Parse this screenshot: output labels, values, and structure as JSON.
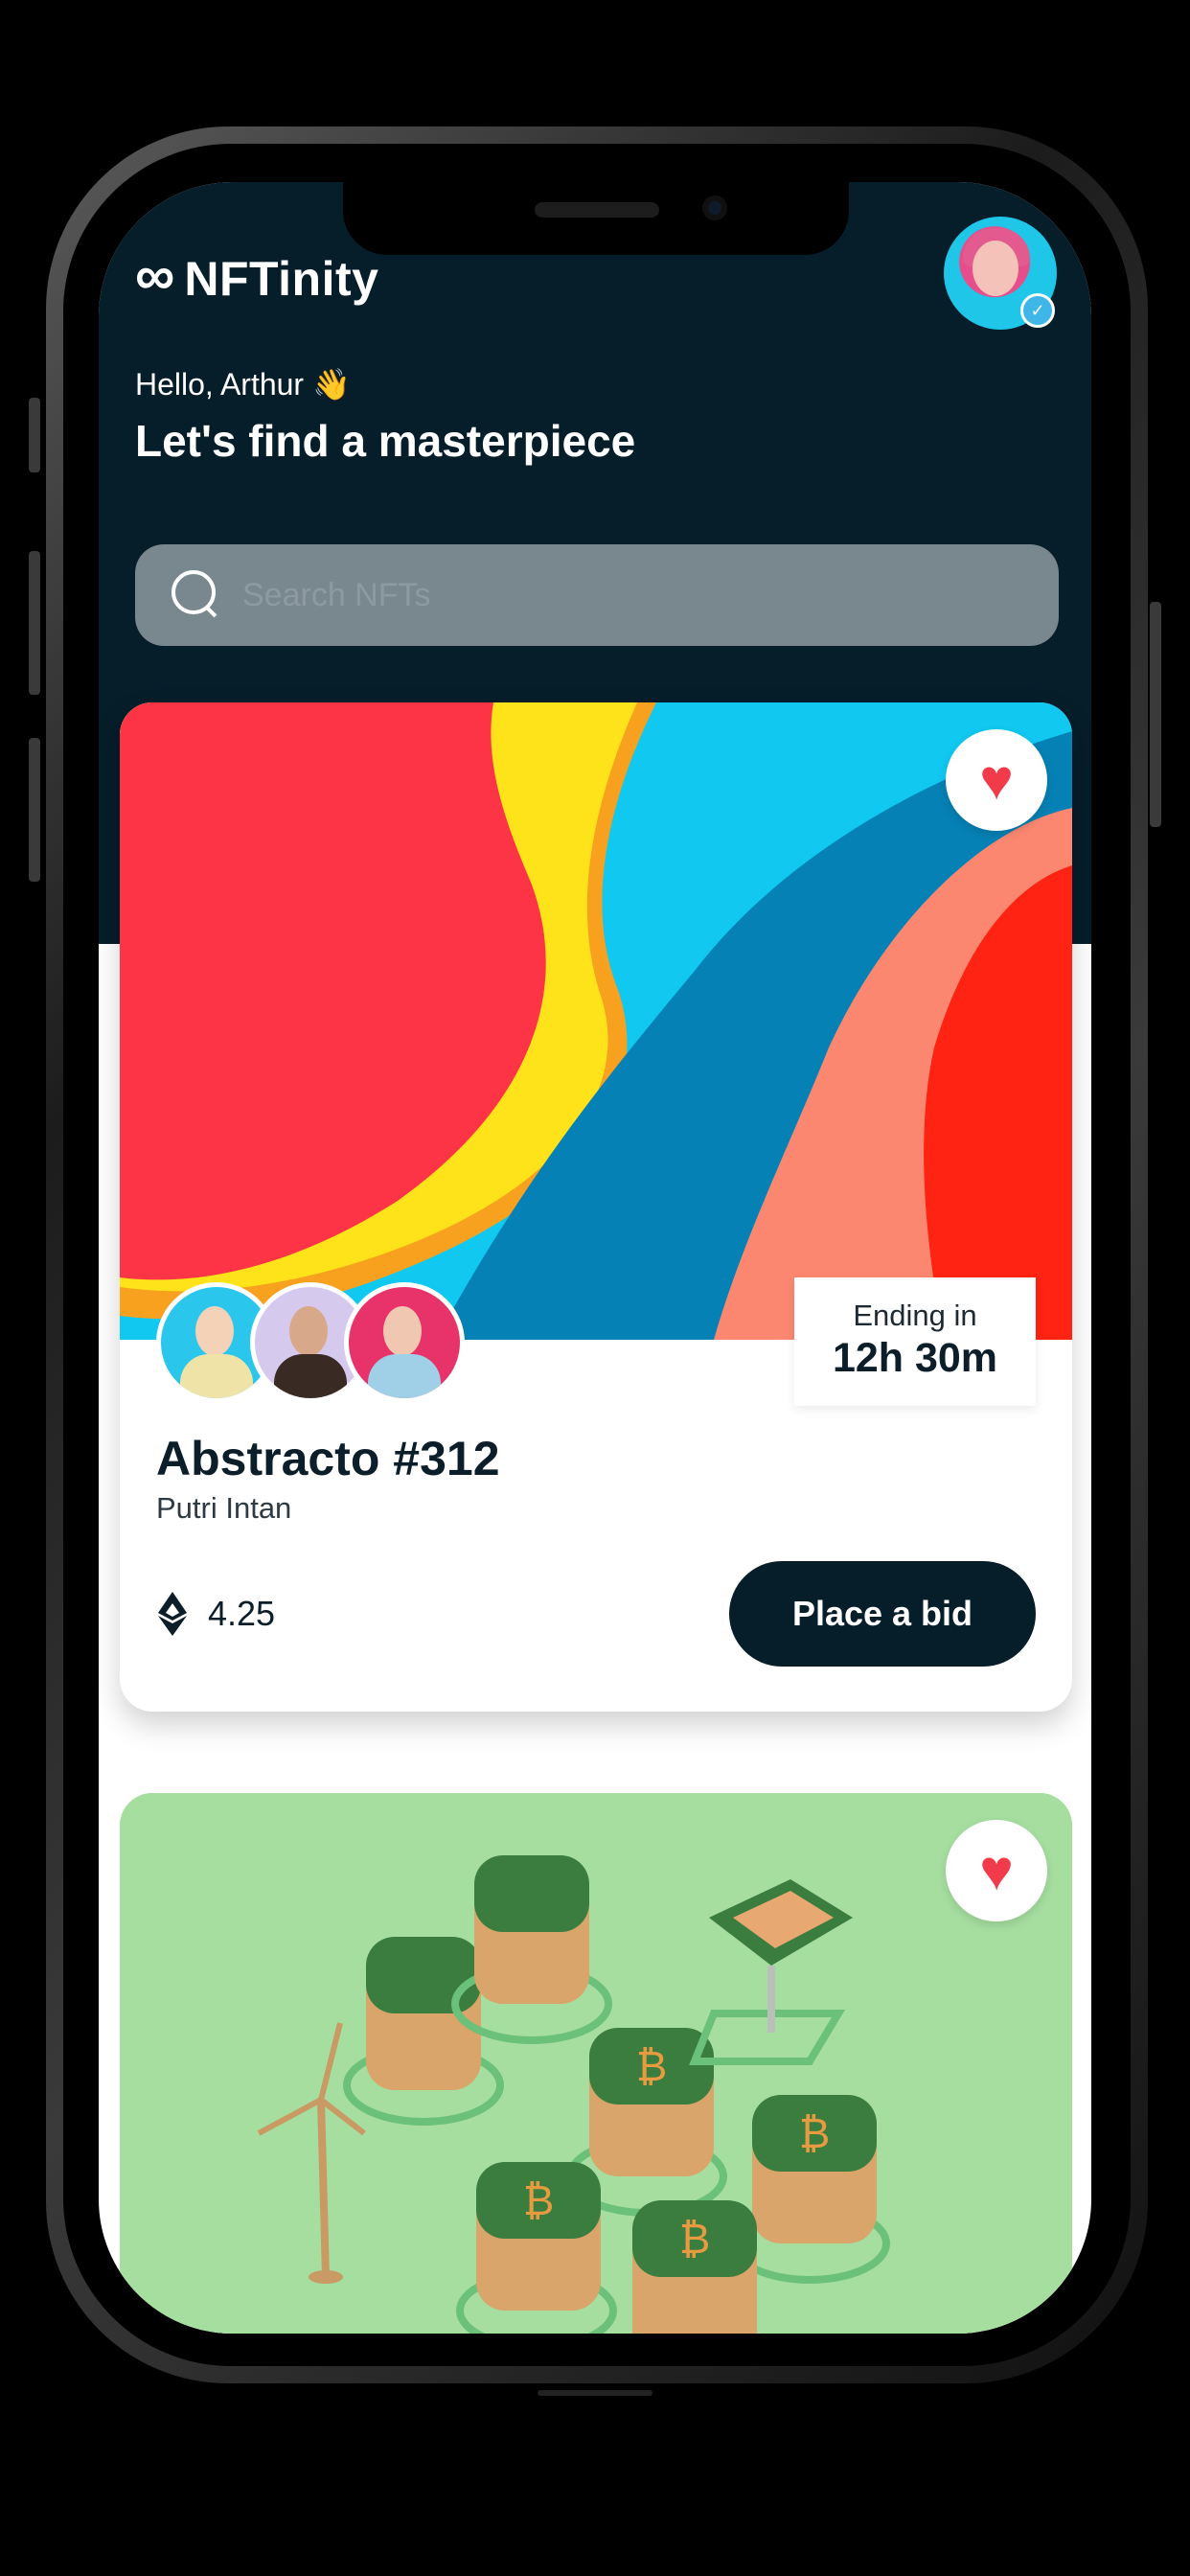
{
  "app": {
    "logo_symbol": "∞",
    "name": "NFTinity"
  },
  "user": {
    "greeting": "Hello, Arthur 👋",
    "avatar_icon": "user-avatar-verified"
  },
  "hero": {
    "headline": "Let's find a masterpiece"
  },
  "search": {
    "placeholder": "Search NFTs",
    "icon": "search-icon"
  },
  "cards": [
    {
      "title": "Abstracto #312",
      "creator": "Putri Intan",
      "ending_label": "Ending in",
      "ending_time": "12h 30m",
      "price": "4.25",
      "currency_icon": "ethereum-icon",
      "bid_label": "Place a bid",
      "favorite_icon": "heart-icon",
      "favorited": true
    },
    {
      "favorite_icon": "heart-icon",
      "favorited": true
    }
  ],
  "colors": {
    "header_bg": "#061d2a",
    "search_bg": "#79878f",
    "heart": "#f23b4a",
    "button_bg": "#061d2a",
    "art2_bg": "#a6dea0"
  }
}
